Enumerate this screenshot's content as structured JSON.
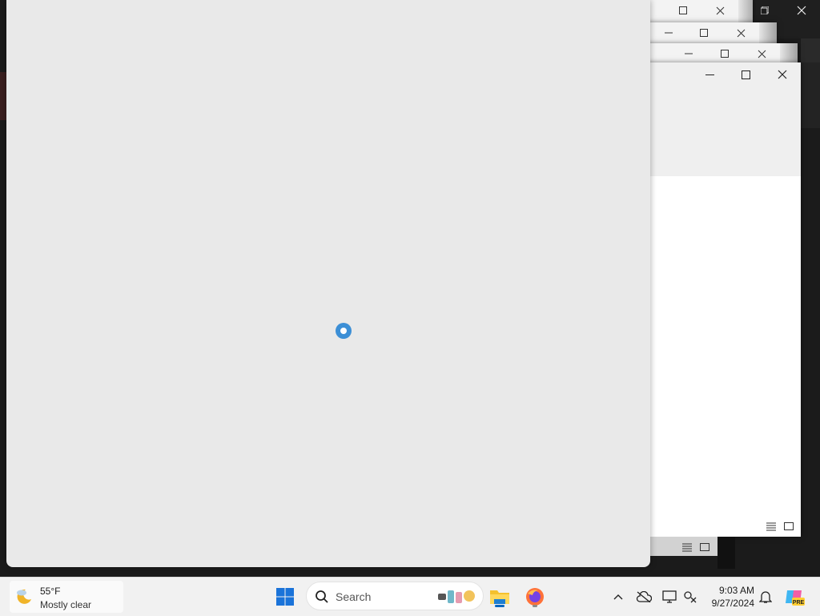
{
  "taskbar": {
    "weather": {
      "temperature": "55°F",
      "condition": "Mostly clear",
      "icon": "moon-cloud-icon"
    },
    "search": {
      "label": "Search"
    },
    "pinned": [
      {
        "name": "start",
        "icon": "windows-logo-icon"
      },
      {
        "name": "file-explorer",
        "icon": "folder-icon"
      },
      {
        "name": "firefox",
        "icon": "firefox-icon"
      }
    ],
    "tray": {
      "icons": [
        "chevron-up-icon",
        "cloud-off-icon",
        "display-icon",
        "network-icon",
        "bell-icon",
        "copilot-icon"
      ],
      "copilot_badge": "PRE"
    },
    "clock": {
      "time": "9:03 AM",
      "date": "9/27/2024"
    }
  },
  "main_window": {
    "state": "loading",
    "spinner_color": "#3c8fd6"
  },
  "colors": {
    "accent": "#0067c0",
    "taskbar_bg": "#f1f1f1",
    "window_bg": "#e9e9e9"
  }
}
